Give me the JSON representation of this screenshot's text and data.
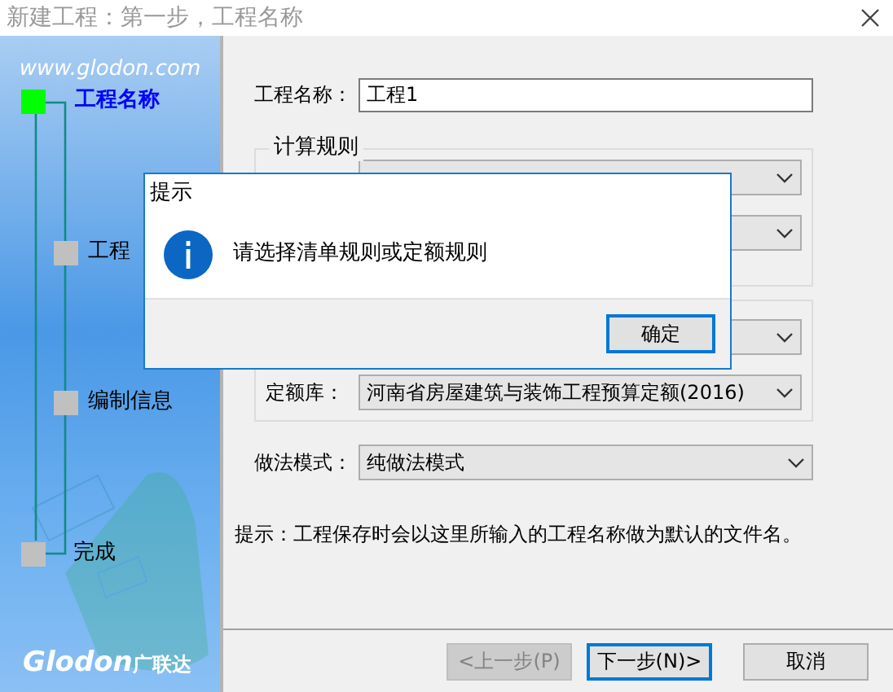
{
  "window": {
    "title": "新建工程：第一步，工程名称"
  },
  "sidebar": {
    "url": "www.glodon.com",
    "steps": [
      {
        "label": "工程名称",
        "selected": true
      },
      {
        "label": "工程",
        "selected": false
      },
      {
        "label": "编制信息",
        "selected": false
      },
      {
        "label": "完成",
        "selected": false
      }
    ],
    "logo": {
      "latin": "Glodon",
      "chinese": "广联达"
    }
  },
  "form": {
    "project_name": {
      "label": "工程名称：",
      "value": "工程1"
    },
    "groups": [
      {
        "title": "计算规则",
        "rows": [
          {
            "kind": "select"
          },
          {
            "kind": "select"
          }
        ]
      },
      {
        "rows": [
          {
            "kind": "select"
          },
          {
            "kind": "select",
            "label": "定额库：",
            "value": "河南省房屋建筑与装饰工程预算定额(2016)"
          }
        ]
      }
    ],
    "method": {
      "label": "做法模式：",
      "value": "纯做法模式"
    },
    "hint": "提示：工程保存时会以这里所输入的工程名称做为默认的文件名。"
  },
  "buttons": [
    {
      "label": "<上一步(P)",
      "disabled": true,
      "focused": false
    },
    {
      "label": "下一步(N)>",
      "disabled": false,
      "focused": true
    },
    {
      "label": "取消",
      "disabled": false,
      "focused": false
    }
  ],
  "dialog": {
    "title": "提示",
    "message": "请选择清单规则或定额规则",
    "button": "确定"
  }
}
